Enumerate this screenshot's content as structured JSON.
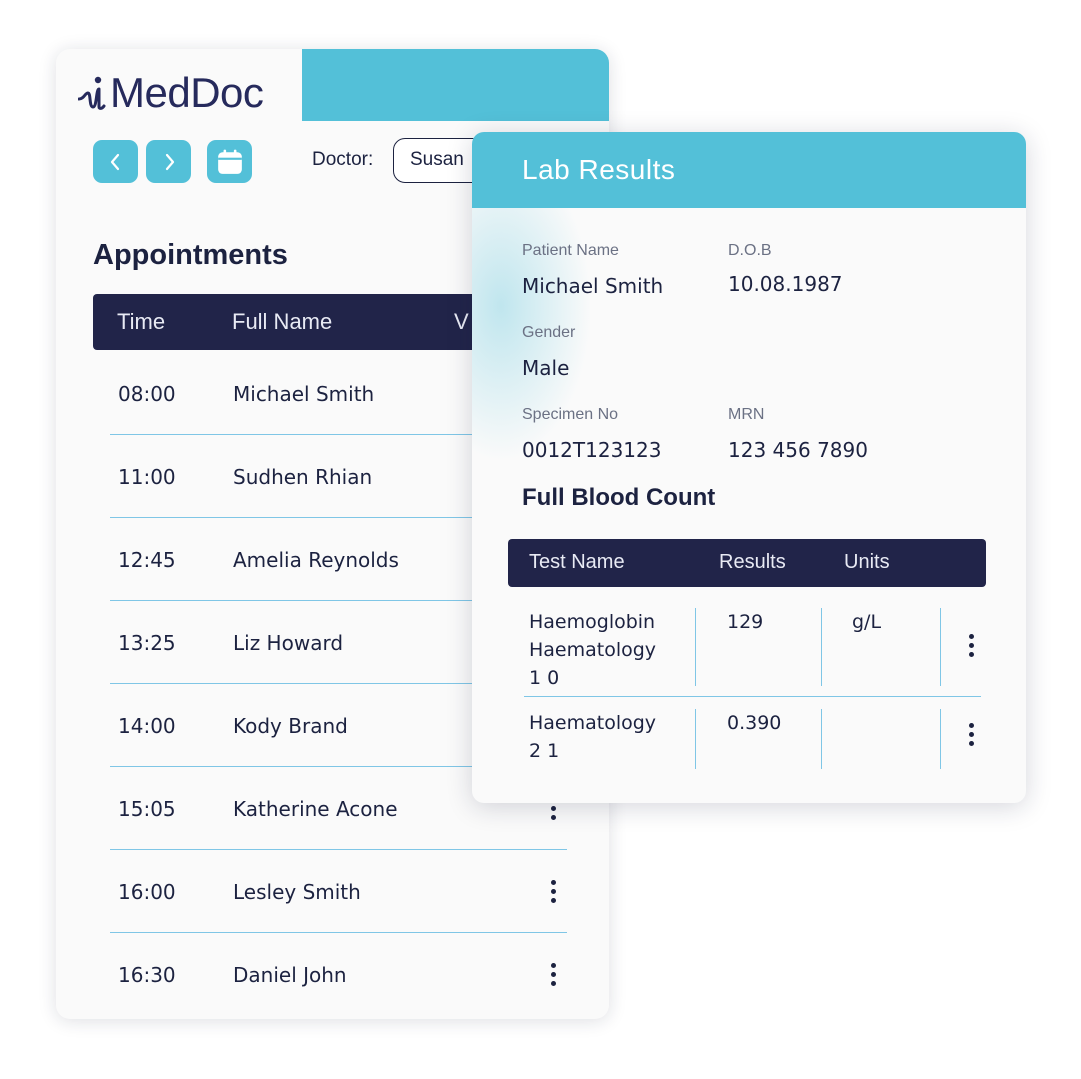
{
  "brand": {
    "logo_text": "MedDoc",
    "logo_icon": "heartbeat-i-icon",
    "accent": "#53c0d8",
    "dark": "#212449"
  },
  "toolbar": {
    "prev_icon": "chevron-left-icon",
    "next_icon": "chevron-right-icon",
    "calendar_icon": "calendar-icon",
    "doctor_label": "Doctor:",
    "doctor_value": "Susan"
  },
  "appointments": {
    "title": "Appointments",
    "columns": {
      "time": "Time",
      "full_name": "Full Name",
      "visit": "V"
    },
    "rows": [
      {
        "time": "08:00",
        "name": "Michael Smith"
      },
      {
        "time": "11:00",
        "name": "Sudhen Rhian"
      },
      {
        "time": "12:45",
        "name": "Amelia Reynolds"
      },
      {
        "time": "13:25",
        "name": "Liz Howard"
      },
      {
        "time": "14:00",
        "name": "Kody Brand"
      },
      {
        "time": "15:05",
        "name": "Katherine Acone"
      },
      {
        "time": "16:00",
        "name": "Lesley Smith"
      },
      {
        "time": "16:30",
        "name": "Daniel John"
      }
    ]
  },
  "lab": {
    "title": "Lab Results",
    "patient_name_label": "Patient Name",
    "patient_name": "Michael Smith",
    "dob_label": "D.O.B",
    "dob": "10.08.1987",
    "gender_label": "Gender",
    "gender": "Male",
    "specimen_label": "Specimen No",
    "specimen": "0012T123123",
    "mrn_label": "MRN",
    "mrn": "123 456 7890",
    "section_title": "Full Blood Count",
    "columns": {
      "test_name": "Test Name",
      "results": "Results",
      "units": "Units"
    },
    "rows": [
      {
        "test_name_lines": [
          "Haemoglobin",
          "Haematology",
          "1 0"
        ],
        "result": "129",
        "unit": "g/L"
      },
      {
        "test_name_lines": [
          "Haematology",
          "2 1"
        ],
        "result": "0.390",
        "unit": ""
      }
    ]
  }
}
